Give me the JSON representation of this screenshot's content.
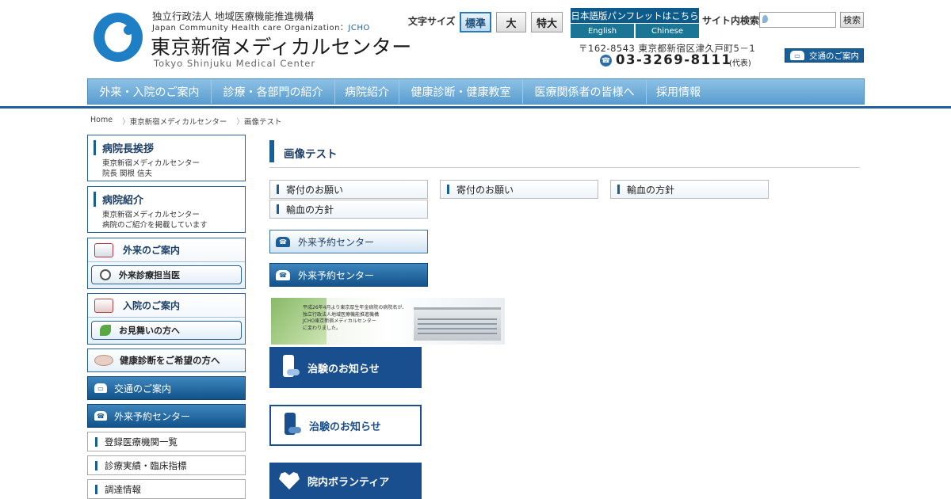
{
  "header": {
    "org_jp": "独立行政法人 地域医療機能推進機構",
    "org_en": "Japan Community Health care Organization：",
    "org_abbr": "JCHO",
    "title": "東京新宿メディカルセンター",
    "title_en": "Tokyo Shinjuku Medical Center",
    "font_size_label": "文字サイズ",
    "font_sizes": [
      "標準",
      "大",
      "特大"
    ],
    "pamphlet_link": "日本語版パンフレットはこちら",
    "languages": [
      "English",
      "Chinese"
    ],
    "search_label": "サイト内検索",
    "search_placeholder": "",
    "search_button": "検索",
    "address": "〒162-8543 東京都新宿区津久戸町5－1",
    "phone": "03-3269-8111",
    "phone_note": "(代表)",
    "access_button": "交通のご案内"
  },
  "nav": {
    "items": [
      "外来・入院のご案内",
      "診療・各部門の紹介",
      "病院紹介",
      "健康診断・健康教室",
      "医療関係者の皆様へ",
      "採用情報"
    ]
  },
  "breadcrumb": [
    "Home",
    "東京新宿メディカルセンター",
    "画像テスト"
  ],
  "sidebar": {
    "director": {
      "heading": "病院長挨拶",
      "line1": "東京新宿メディカルセンター",
      "line2": "院長 関根 信夫"
    },
    "intro": {
      "heading": "病院紹介",
      "line1": "東京新宿メディカルセンター",
      "line2": "病院のご紹介を掲載しています"
    },
    "outpatient": {
      "label": "外来のご案内",
      "sub": "外来診療担当医"
    },
    "inpatient": {
      "label": "入院のご案内",
      "sub": "お見舞いの方へ"
    },
    "checkup": "健康診断をご希望の方へ",
    "access": "交通のご案内",
    "reservation": "外来予約センター",
    "links": [
      "登録医療機関一覧",
      "診療実績・臨床指標",
      "調達情報"
    ]
  },
  "main": {
    "page_title": "画像テスト",
    "items": [
      "寄付のお願い",
      "寄付のお願い",
      "輸血の方針",
      "輸血の方針"
    ],
    "reservation_light": "外来予約センター",
    "reservation_dark": "外来予約センター",
    "banner_lines": [
      "平成26年4月より東京厚生年金病院の病院名が、",
      "独立行政法人地域医療機能推進機構",
      "JCHO東京新宿メディカルセンター",
      "に変わりました。"
    ],
    "trial_dark": "治験のお知らせ",
    "trial_light": "治験のお知らせ",
    "volunteer": "院内ボランティア"
  },
  "colors": {
    "primary": "#1a5e98",
    "nav_light": "#8dc1e6",
    "nav_dark": "#5a9dcf",
    "banner_navy": "#1a4f8f"
  }
}
